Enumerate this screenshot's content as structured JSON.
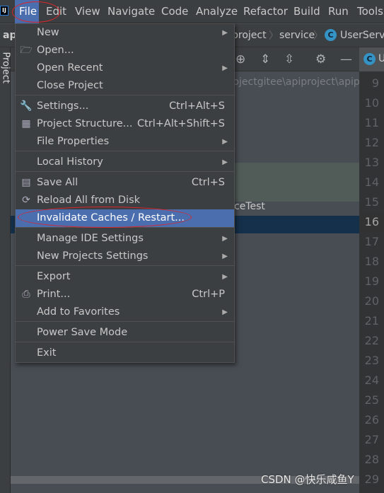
{
  "menubar": {
    "items": [
      "File",
      "Edit",
      "View",
      "Navigate",
      "Code",
      "Analyze",
      "Refactor",
      "Build",
      "Run",
      "Tools"
    ],
    "active": "File"
  },
  "navbar": {
    "project_short": "ap",
    "crumbs": [
      "project",
      "service",
      "UserServic"
    ]
  },
  "toolwindow": {
    "label": "Project"
  },
  "path_text": "rojectgitee\\apiproject\\apip",
  "tree_text": "ceTest",
  "editor_tab": "U",
  "gutter": {
    "lines": [
      "9",
      "10",
      "11",
      "12",
      "13",
      "14",
      "15",
      "16",
      "17",
      "18",
      "19",
      "20",
      "21",
      "22",
      "23",
      "24",
      "25",
      "26",
      "27",
      "28",
      "29"
    ],
    "current": "16"
  },
  "file_menu": {
    "items": [
      {
        "label": "New",
        "submenu": true
      },
      {
        "label": "Open...",
        "icon": "folder-icon"
      },
      {
        "label": "Open Recent",
        "submenu": true
      },
      {
        "label": "Close Project"
      },
      {
        "label": "Settings...",
        "shortcut": "Ctrl+Alt+S",
        "icon": "wrench-icon"
      },
      {
        "label": "Project Structure...",
        "shortcut": "Ctrl+Alt+Shift+S",
        "icon": "project-structure-icon"
      },
      {
        "label": "File Properties",
        "submenu": true
      },
      {
        "label": "Local History",
        "submenu": true
      },
      {
        "label": "Save All",
        "shortcut": "Ctrl+S",
        "icon": "save-icon"
      },
      {
        "label": "Reload All from Disk",
        "icon": "reload-icon"
      },
      {
        "label": "Invalidate Caches / Restart...",
        "selected": true
      },
      {
        "label": "Manage IDE Settings",
        "submenu": true
      },
      {
        "label": "New Projects Settings",
        "submenu": true
      },
      {
        "label": "Export",
        "submenu": true
      },
      {
        "label": "Print...",
        "shortcut": "Ctrl+P",
        "icon": "print-icon"
      },
      {
        "label": "Add to Favorites",
        "submenu": true
      },
      {
        "label": "Power Save Mode"
      },
      {
        "label": "Exit"
      }
    ]
  },
  "watermark": "CSDN @快乐咸鱼Y",
  "colors": {
    "selection": "#4b6eaf",
    "annotation": "#d8262c",
    "menu_bg": "#3c3f41"
  }
}
